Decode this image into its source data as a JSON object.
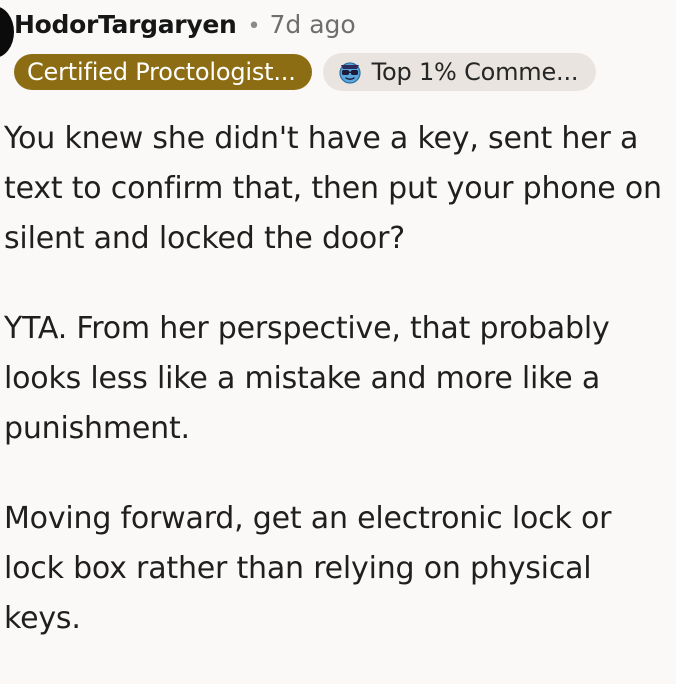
{
  "comment": {
    "author": "HodorTargaryen",
    "separator": "•",
    "time": "7d ago",
    "flairs": {
      "user_flair": "Certified Proctologist...",
      "achievement": "Top 1% Comme...",
      "achievement_icon": "sunglasses-face-icon"
    },
    "paragraphs": [
      "You knew she didn't have a key, sent her a text to confirm that, then put your phone on silent and locked the door?",
      "YTA. From her perspective, that probably looks less like a mistake and more like a punishment.",
      "Moving forward, get an electronic lock or lock box rather than relying on physical keys."
    ]
  },
  "colors": {
    "background": "#fbf9f7",
    "user_flair_bg": "#8c6d13",
    "achievement_bg": "#e9e4df"
  }
}
